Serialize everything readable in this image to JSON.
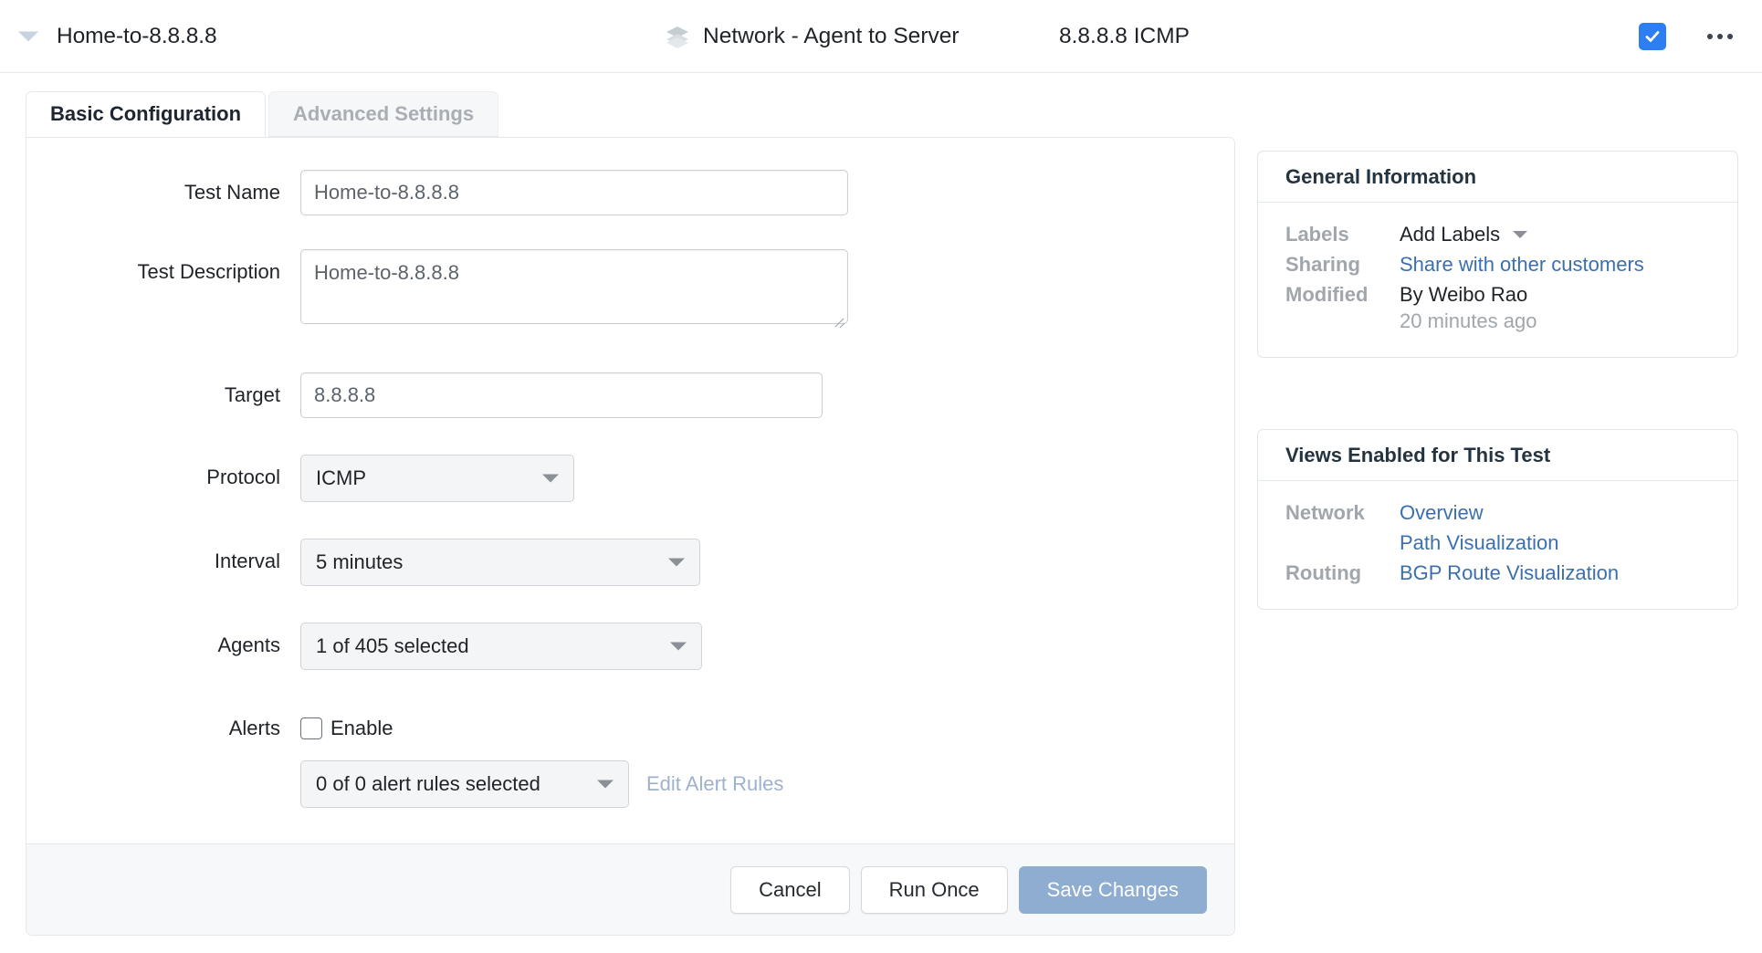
{
  "header": {
    "collapse_icon": "caret-down-icon",
    "test_title": "Home-to-8.8.8.8",
    "layers_icon": "layers-icon",
    "test_type": "Network - Agent to Server",
    "target_protocol": "8.8.8.8 ICMP",
    "enabled_checkbox_icon": "checkmark-icon",
    "enabled_checked": true,
    "more_menu_icon": "kebab-menu-icon",
    "accent_color": "#2c7ef2"
  },
  "tabs": [
    {
      "label": "Basic Configuration",
      "active": true
    },
    {
      "label": "Advanced Settings",
      "active": false
    }
  ],
  "form": {
    "test_name": {
      "label": "Test Name",
      "value": "Home-to-8.8.8.8",
      "placeholder": "Test Name"
    },
    "test_description": {
      "label": "Test Description",
      "value": "Home-to-8.8.8.8",
      "placeholder": "Test Description"
    },
    "target": {
      "label": "Target",
      "value": "8.8.8.8",
      "placeholder": "Target"
    },
    "protocol": {
      "label": "Protocol",
      "value": "ICMP",
      "caret_icon": "caret-down-icon"
    },
    "interval": {
      "label": "Interval",
      "value": "5 minutes",
      "caret_icon": "caret-down-icon"
    },
    "agents": {
      "label": "Agents",
      "value": "1 of 405 selected",
      "caret_icon": "caret-down-icon"
    },
    "alerts": {
      "label": "Alerts",
      "enable_label": "Enable",
      "enable_checked": false,
      "rules_value": "0 of 0 alert rules selected",
      "rules_caret_icon": "caret-down-icon",
      "edit_rules_label": "Edit Alert Rules"
    }
  },
  "footer": {
    "cancel_label": "Cancel",
    "run_once_label": "Run Once",
    "save_label": "Save Changes",
    "save_color": "#8fadd1"
  },
  "general_information": {
    "title": "General Information",
    "labels_key": "Labels",
    "labels_value": "Add Labels",
    "labels_caret_icon": "caret-down-icon",
    "sharing_key": "Sharing",
    "sharing_value": "Share with other customers",
    "modified_key": "Modified",
    "modified_value": "By Weibo Rao",
    "modified_time": "20 minutes ago",
    "link_color": "#3b6fad"
  },
  "views_enabled": {
    "title": "Views Enabled for This Test",
    "network_key": "Network",
    "network_view_1": "Overview",
    "network_view_2": "Path Visualization",
    "routing_key": "Routing",
    "routing_view_1": "BGP Route Visualization"
  }
}
